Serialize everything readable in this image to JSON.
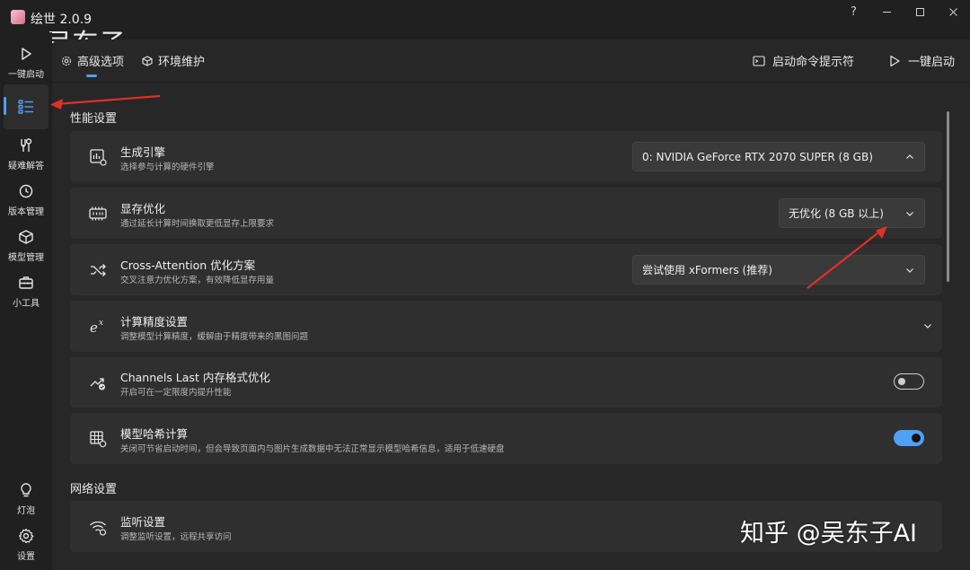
{
  "app": {
    "title": "绘世 2.0.9"
  },
  "watermark": {
    "top": "@吴东子",
    "bottom": "知乎 @吴东子AI"
  },
  "window_controls": {
    "help": "?",
    "minimize": "—",
    "maximize": "☐",
    "close": "✕"
  },
  "sidebar": {
    "items": [
      {
        "label": "一键启动",
        "icon": "play-icon"
      },
      {
        "label": "",
        "icon": "list-settings-icon",
        "active": true
      },
      {
        "label": "疑难解答",
        "icon": "tools-icon"
      },
      {
        "label": "版本管理",
        "icon": "history-icon"
      },
      {
        "label": "模型管理",
        "icon": "cube-icon"
      },
      {
        "label": "小工具",
        "icon": "toolbox-icon"
      }
    ],
    "bottom_items": [
      {
        "label": "灯泡",
        "icon": "lightbulb-icon"
      },
      {
        "label": "设置",
        "icon": "gear-icon"
      }
    ]
  },
  "topbar": {
    "tabs": [
      {
        "label": "高级选项",
        "icon": "gear-small-icon",
        "active": true
      },
      {
        "label": "环境维护",
        "icon": "package-icon"
      }
    ],
    "actions": [
      {
        "label": "启动命令提示符",
        "icon": "terminal-icon"
      },
      {
        "label": "一键启动",
        "icon": "play-outline-icon"
      }
    ]
  },
  "sections": {
    "performance": "性能设置",
    "network": "网络设置"
  },
  "cards": {
    "engine": {
      "title": "生成引擎",
      "desc": "选择参与计算的硬件引擎",
      "value": "0: NVIDIA GeForce RTX 2070 SUPER (8 GB)"
    },
    "vram": {
      "title": "显存优化",
      "desc": "通过延长计算时间换取更低显存上限要求",
      "value": "无优化 (8 GB 以上)"
    },
    "attention": {
      "title": "Cross-Attention 优化方案",
      "desc": "交叉注意力优化方案，有效降低显存用量",
      "value": "尝试使用 xFormers (推荐)"
    },
    "precision": {
      "title": "计算精度设置",
      "desc": "调整模型计算精度，缓解由于精度带来的黑图问题"
    },
    "channels_last": {
      "title": "Channels Last 内存格式优化",
      "desc": "开启可在一定限度内提升性能",
      "enabled": false
    },
    "model_hash": {
      "title": "模型哈希计算",
      "desc": "关闭可节省启动时间，但会导致页面内与图片生成数据中无法正常显示模型哈希信息，适用于低速硬盘",
      "enabled": true
    },
    "listen": {
      "title": "监听设置",
      "desc": "调整监听设置，远程共享访问"
    }
  },
  "colors": {
    "accent": "#4ea1f3",
    "annotation_arrow": "#e0302a"
  }
}
